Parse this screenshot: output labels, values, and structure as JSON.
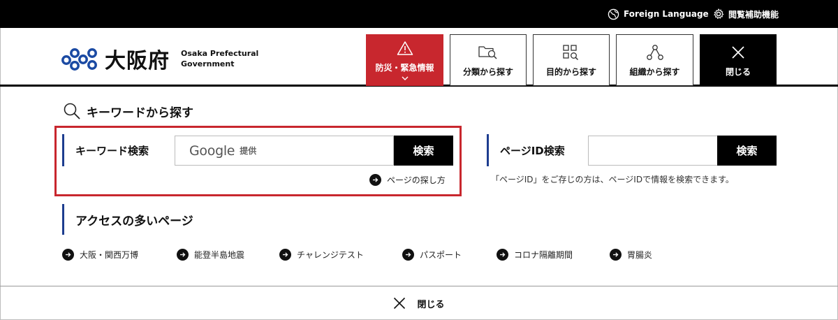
{
  "topbar": {
    "foreign_language": "Foreign Language",
    "accessibility": "閲覧補助機能"
  },
  "logo": {
    "name": "大阪府",
    "en_line1": "Osaka Prefectural",
    "en_line2": "Government"
  },
  "header_buttons": {
    "disaster": "防災・緊急情報",
    "by_category": "分類から探す",
    "by_purpose": "目的から探す",
    "by_organization": "組織から探す",
    "close": "閉じる"
  },
  "keyword_search": {
    "section_title": "キーワードから探す",
    "label": "キーワード検索",
    "google_logo": "Google",
    "google_sub": "提供",
    "button": "検索",
    "help_link": "ページの探し方"
  },
  "page_id_search": {
    "label": "ページID検索",
    "button": "検索",
    "note": "「ページID」をご存じの方は、ページIDで情報を検索できます。"
  },
  "popular": {
    "title": "アクセスの多いページ",
    "links": [
      "大阪・関西万博",
      "能登半島地震",
      "チャレンジテスト",
      "パスポート",
      "コロナ隔離期間",
      "胃腸炎"
    ]
  },
  "bottom": {
    "close": "閉じる"
  },
  "colors": {
    "accent_red": "#c8272e",
    "accent_blue": "#1d3d8f",
    "logo_blue": "#1b4aa3"
  }
}
